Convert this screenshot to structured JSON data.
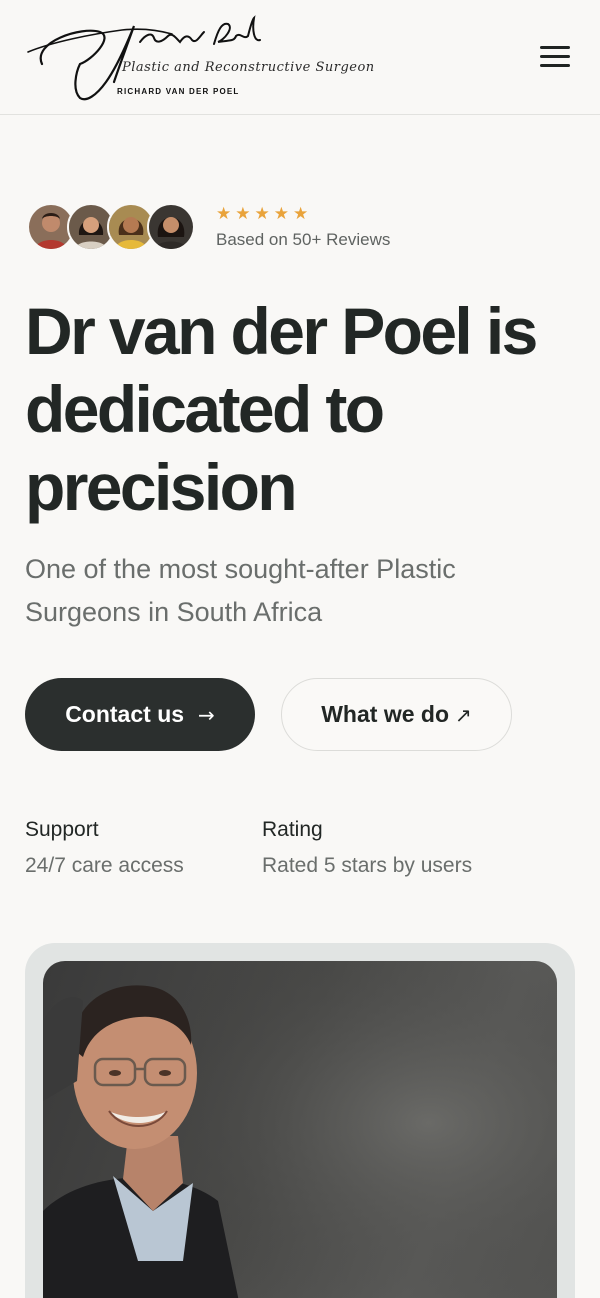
{
  "header": {
    "logo": {
      "signature": "R.J. van der Poel",
      "subtitle": "Plastic and Reconstructive Surgeon",
      "name": "RICHARD VAN DER POEL"
    },
    "menu_icon": "hamburger-menu-icon"
  },
  "reviews": {
    "stars": "★★★★★",
    "rating": 5,
    "text": "Based on 50+ Reviews",
    "avatars": [
      "reviewer-avatar-1",
      "reviewer-avatar-2",
      "reviewer-avatar-3",
      "reviewer-avatar-4"
    ]
  },
  "hero": {
    "title": "Dr van der Poel is dedicated to precision",
    "subtitle": "One of the most sought-after Plastic Surgeons in South Africa"
  },
  "buttons": {
    "contact": {
      "label": "Contact us",
      "icon": "→"
    },
    "what": {
      "label": "What we do",
      "icon": "↗"
    }
  },
  "stats": [
    {
      "label": "Support",
      "value": "24/7 care access"
    },
    {
      "label": "Rating",
      "value": "Rated 5 stars by users"
    }
  ],
  "colors": {
    "background": "#f9f8f6",
    "text": "#222725",
    "muted": "#6a6e6c",
    "star": "#e9a33b",
    "primary_button": "#2b2f2e",
    "frame": "#e1e4e3"
  }
}
